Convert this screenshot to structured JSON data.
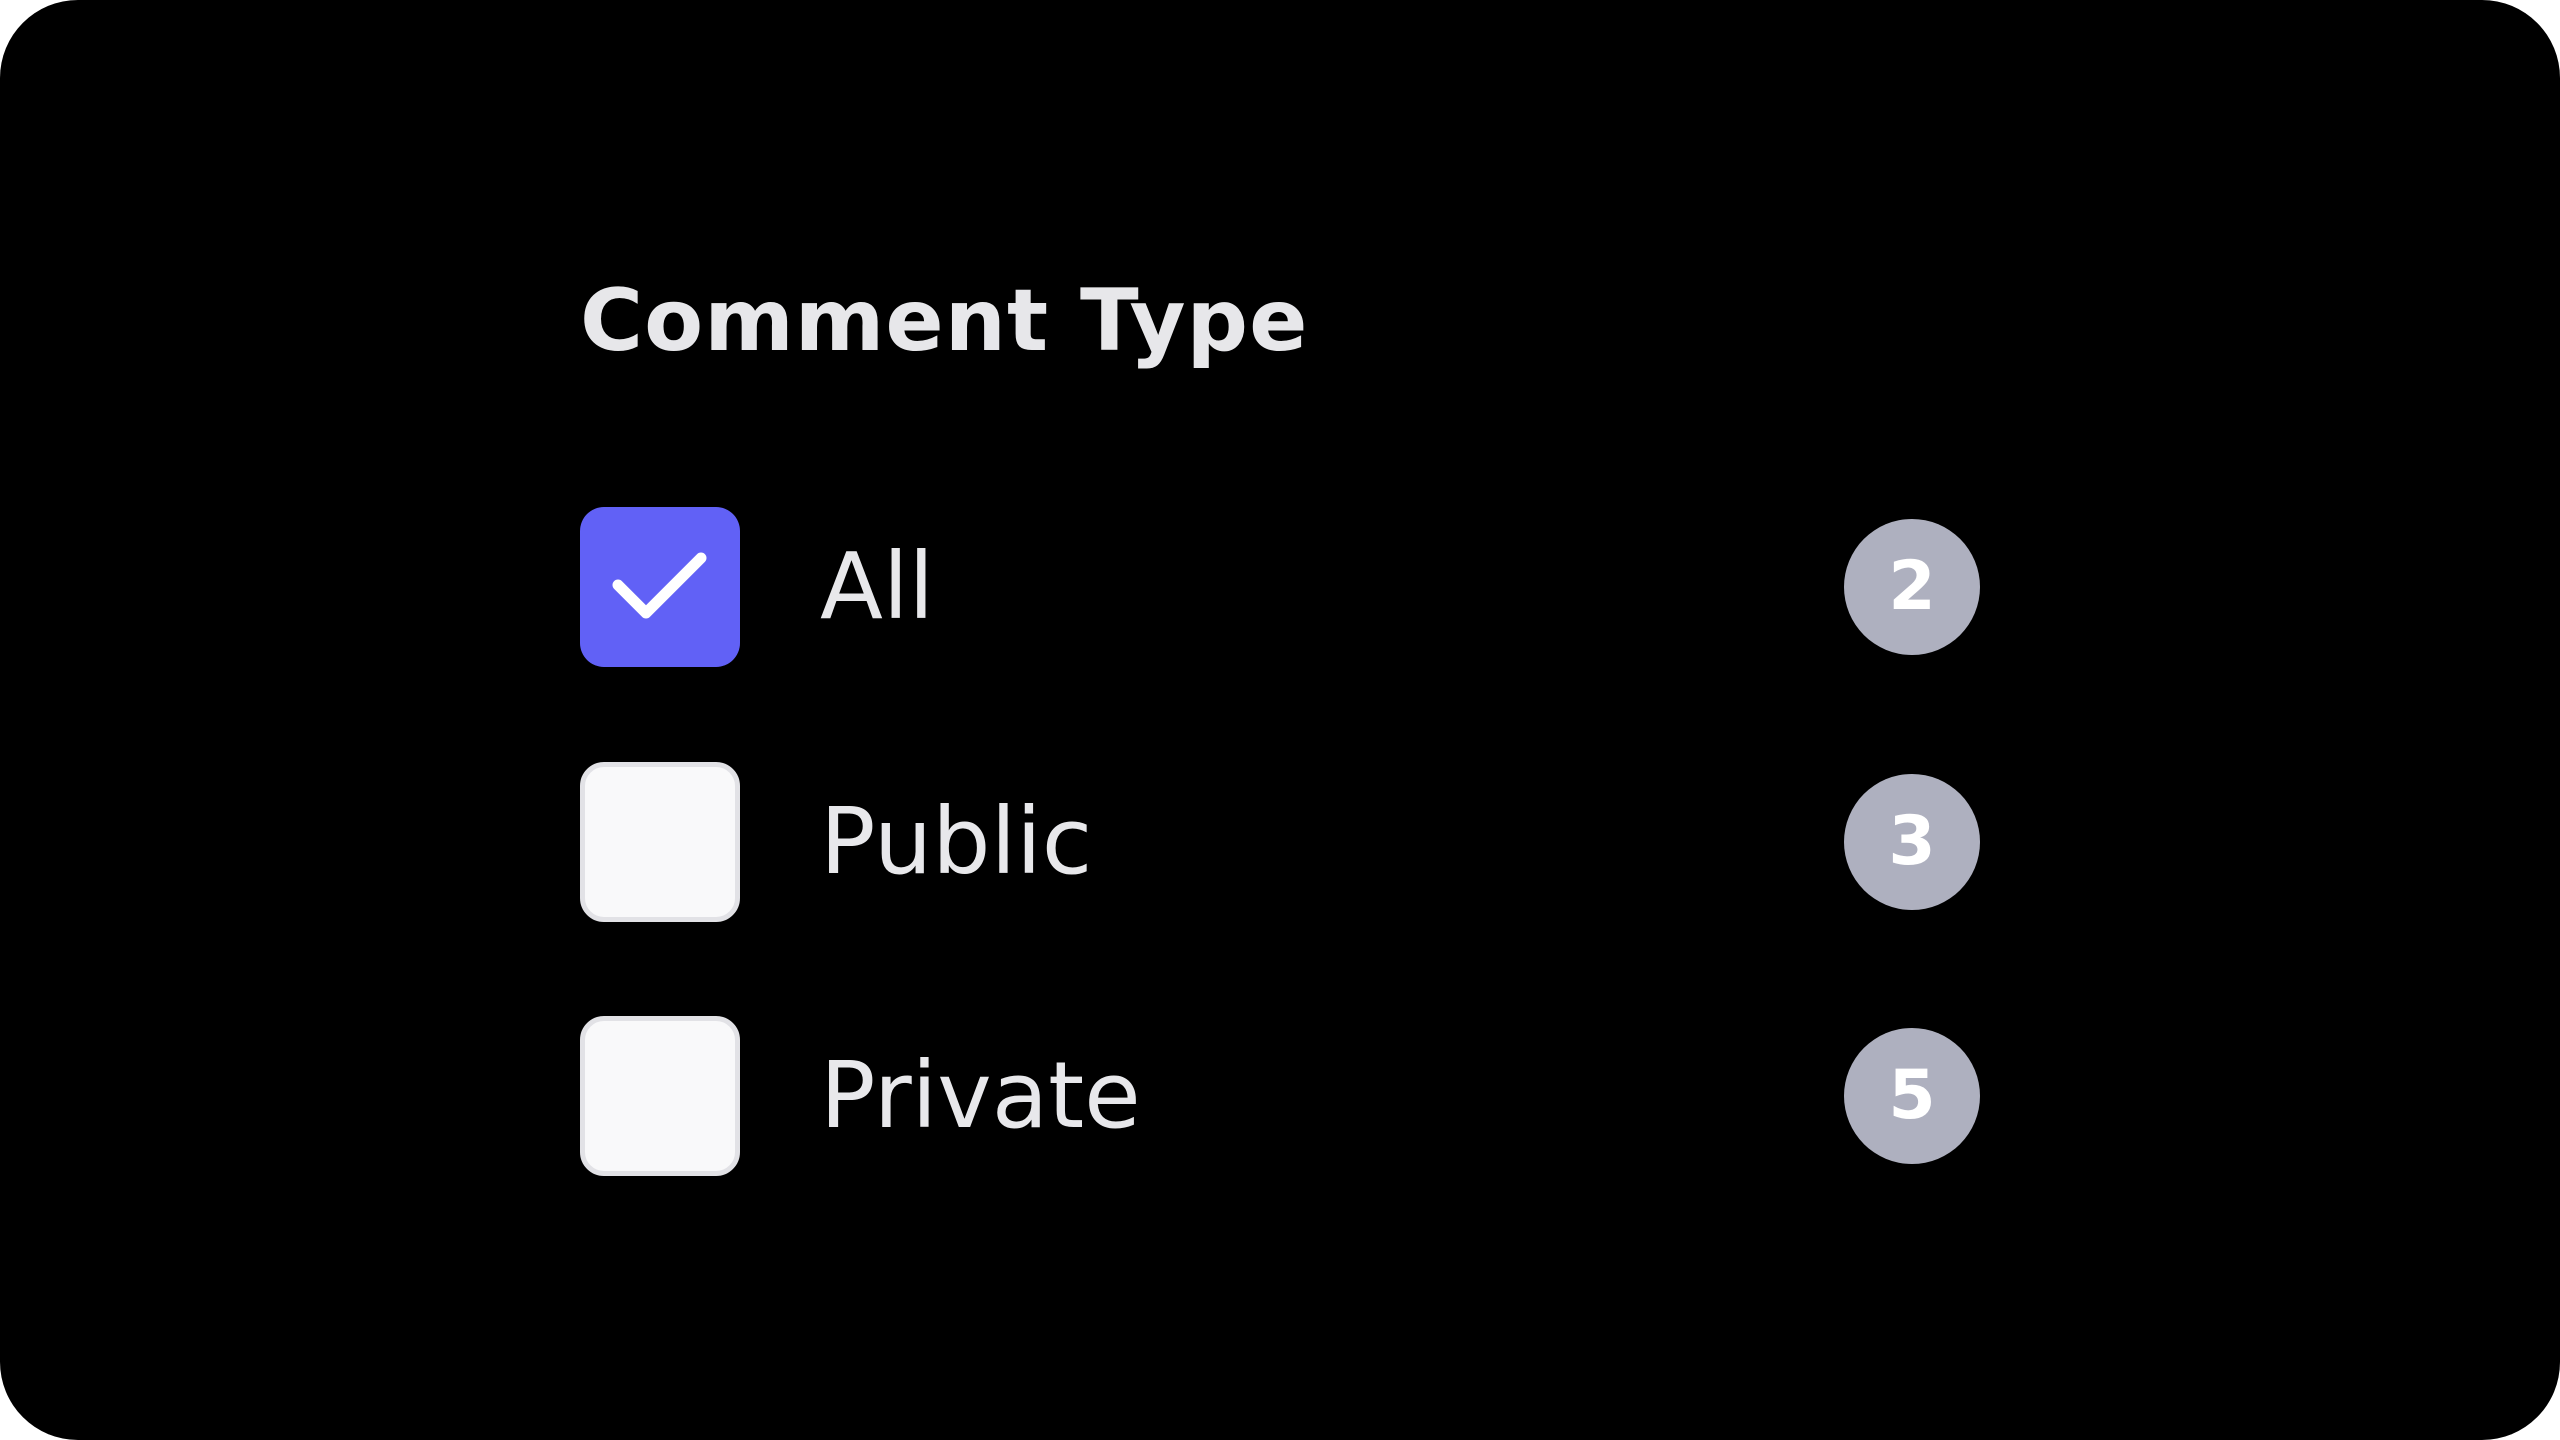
{
  "filter": {
    "title": "Comment Type",
    "options": [
      {
        "label": "All",
        "count": "2",
        "checked": true
      },
      {
        "label": "Public",
        "count": "3",
        "checked": false
      },
      {
        "label": "Private",
        "count": "5",
        "checked": false
      }
    ]
  },
  "colors": {
    "background": "#000000",
    "checked_fill": "#6161f6",
    "unchecked_fill": "#f9f9fa",
    "unchecked_border": "#e2e2e6",
    "badge_fill": "#aeb0bf",
    "text": "#e8e8eb"
  },
  "icons": {
    "checked": "checkmark-icon"
  }
}
